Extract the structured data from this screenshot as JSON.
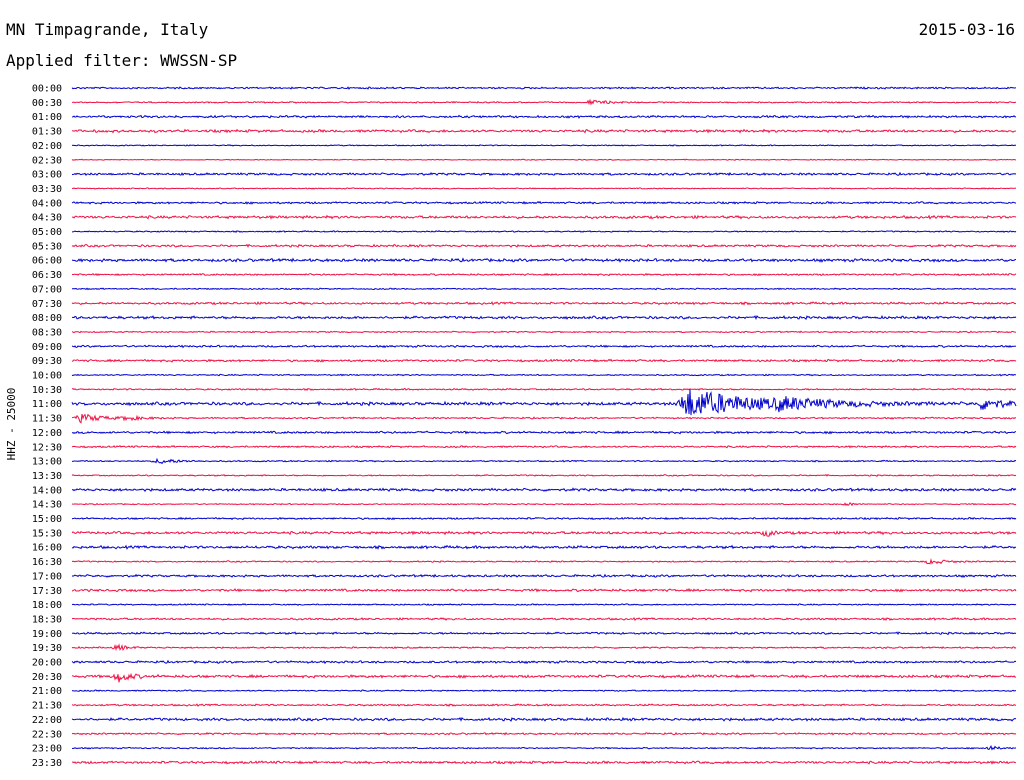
{
  "header": {
    "station": "MN Timpagrande, Italy",
    "date": "2015-03-16",
    "filter": "Applied filter: WWSSN-SP"
  },
  "chart_data": {
    "type": "line",
    "ylabel": "HHZ - 25000",
    "colors": {
      "even": "#0000cc",
      "odd": "#ee1144"
    },
    "row_labels": [
      "00:00",
      "00:30",
      "01:00",
      "01:30",
      "02:00",
      "02:30",
      "03:00",
      "03:30",
      "04:00",
      "04:30",
      "05:00",
      "05:30",
      "06:00",
      "06:30",
      "07:00",
      "07:30",
      "08:00",
      "08:30",
      "09:00",
      "09:30",
      "10:00",
      "10:30",
      "11:00",
      "11:30",
      "12:00",
      "12:30",
      "13:00",
      "13:30",
      "14:00",
      "14:30",
      "15:00",
      "15:30",
      "16:00",
      "16:30",
      "17:00",
      "17:30",
      "18:00",
      "18:30",
      "19:00",
      "19:30",
      "20:00",
      "20:30",
      "21:00",
      "21:30",
      "22:00",
      "22:30",
      "23:00",
      "23:30"
    ],
    "noise_level": [
      0.8,
      0.6,
      1.0,
      1.2,
      0.5,
      0.4,
      1.0,
      0.5,
      0.9,
      1.2,
      0.6,
      1.0,
      1.3,
      0.8,
      0.6,
      1.0,
      1.2,
      0.6,
      0.9,
      1.0,
      0.6,
      0.7,
      1.4,
      0.7,
      1.0,
      0.8,
      0.6,
      0.6,
      1.2,
      0.5,
      0.8,
      1.2,
      1.2,
      0.6,
      1.0,
      1.1,
      0.6,
      0.9,
      0.9,
      0.7,
      1.0,
      1.2,
      0.6,
      0.8,
      1.2,
      0.8,
      0.6,
      1.1
    ],
    "events": [
      {
        "row": "00:30",
        "minute": 16.5,
        "amplitude": 2,
        "duration_min": 1.2
      },
      {
        "row": "11:00",
        "minute": 19.5,
        "amplitude": 15,
        "duration_min": 4.5
      },
      {
        "row": "11:00",
        "minute": 22.5,
        "amplitude": 4,
        "duration_min": 3
      },
      {
        "row": "11:00",
        "minute": 29.0,
        "amplitude": 6,
        "duration_min": 1.2
      },
      {
        "row": "11:30",
        "minute": 0.3,
        "amplitude": 4,
        "duration_min": 1.5
      },
      {
        "row": "11:30",
        "minute": 1.8,
        "amplitude": 2,
        "duration_min": 0.8
      },
      {
        "row": "13:00",
        "minute": 2.8,
        "amplitude": 2.5,
        "duration_min": 1.2
      },
      {
        "row": "14:30",
        "minute": 24.7,
        "amplitude": 1.5,
        "duration_min": 0.4
      },
      {
        "row": "15:30",
        "minute": 22.1,
        "amplitude": 3,
        "duration_min": 0.4
      },
      {
        "row": "16:30",
        "minute": 27.3,
        "amplitude": 2.5,
        "duration_min": 1
      },
      {
        "row": "19:30",
        "minute": 1.5,
        "amplitude": 2.5,
        "duration_min": 0.6
      },
      {
        "row": "20:30",
        "minute": 1.5,
        "amplitude": 5,
        "duration_min": 0.8
      },
      {
        "row": "23:00",
        "minute": 29.2,
        "amplitude": 2.5,
        "duration_min": 0.4
      }
    ]
  }
}
